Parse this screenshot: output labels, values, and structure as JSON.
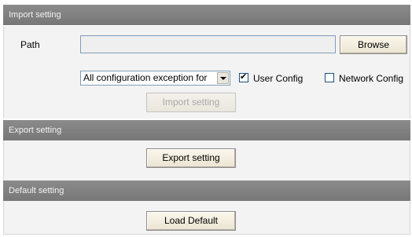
{
  "import_section": {
    "header": "Import setting",
    "path_label": "Path",
    "path_value": "",
    "browse_label": "Browse",
    "select_value": "All configuration exception for",
    "user_config_label": "User Config",
    "user_config_checked": true,
    "network_config_label": "Network Config",
    "network_config_checked": false,
    "import_button_label": "Import setting"
  },
  "export_section": {
    "header": "Export setting",
    "export_button_label": "Export setting"
  },
  "default_section": {
    "header": "Default setting",
    "load_default_label": "Load Default"
  }
}
